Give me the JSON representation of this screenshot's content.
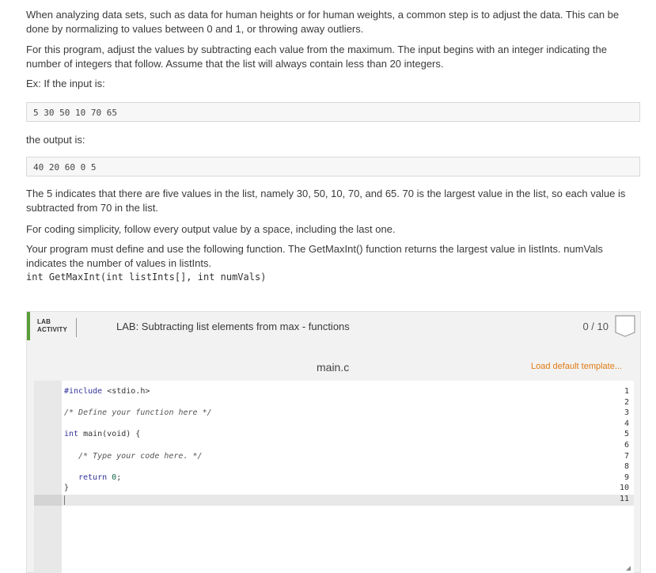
{
  "instructions": {
    "p1": "When analyzing data sets, such as data for human heights or for human weights, a common step is to adjust the data. This can be done by normalizing to values between 0 and 1, or throwing away outliers.",
    "p2": "For this program, adjust the values by subtracting each value from the maximum. The input begins with an integer indicating the number of integers that follow. Assume that the list will always contain less than 20 integers.",
    "p3": "Ex: If the input is:",
    "example_input": "5 30 50 10 70 65",
    "p4": "the output is:",
    "example_output": "40 20 60 0 5",
    "p5": "The 5 indicates that there are five values in the list, namely 30, 50, 10, 70, and 65. 70 is the largest value in the list, so each value is subtracted from 70 in the list.",
    "p6": "For coding simplicity, follow every output value by a space, including the last one.",
    "p7": "Your program must define and use the following function. The GetMaxInt() function returns the largest value in listInts. numVals indicates the number of values in listInts.",
    "signature": "int GetMaxInt(int listInts[], int numVals)"
  },
  "lab": {
    "tag_line1": "LAB",
    "tag_line2": "ACTIVITY",
    "title": "LAB: Subtracting list elements from max - functions",
    "score": "0 / 10",
    "accent_color": "#5a9e3a"
  },
  "editor": {
    "file_name": "main.c",
    "load_template_label": "Load default template...",
    "link_color": "#e07b14",
    "line_numbers": [
      "1",
      "2",
      "3",
      "4",
      "5",
      "6",
      "7",
      "8",
      "9",
      "10",
      "11"
    ],
    "code": {
      "l1_kw": "#include",
      "l1_rest": " <stdio.h>",
      "l3": "/* Define your function here */",
      "l5_kw": "int",
      "l5_rest": " main(void) {",
      "l7": "/* Type your code here. */",
      "l9_kw": "return",
      "l9_num": "0",
      "l9_end": ";",
      "l10": "}"
    }
  }
}
